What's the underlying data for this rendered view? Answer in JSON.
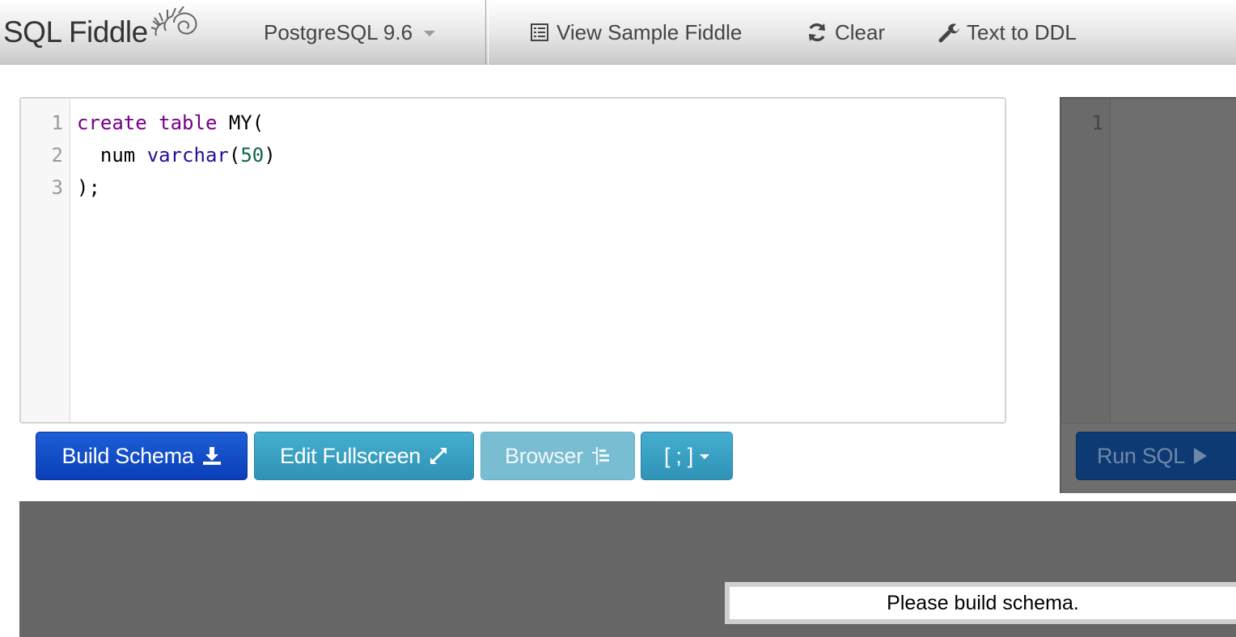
{
  "navbar": {
    "brand": "SQL Fiddle",
    "db_select": "PostgreSQL 9.6",
    "links": {
      "view_sample": "View Sample Fiddle",
      "clear": "Clear",
      "text_to_ddl": "Text to DDL"
    }
  },
  "schema_editor": {
    "line_numbers": [
      "1",
      "2",
      "3"
    ],
    "lines": [
      [
        {
          "t": "create",
          "c": "kw"
        },
        {
          "t": " ",
          "c": ""
        },
        {
          "t": "table",
          "c": "kw"
        },
        {
          "t": " MY(",
          "c": ""
        }
      ],
      [
        {
          "t": "  num ",
          "c": ""
        },
        {
          "t": "varchar",
          "c": "tp"
        },
        {
          "t": "(",
          "c": ""
        },
        {
          "t": "50",
          "c": "nm"
        },
        {
          "t": ")",
          "c": ""
        }
      ],
      [
        {
          "t": ");",
          "c": ""
        }
      ]
    ]
  },
  "query_editor": {
    "line_numbers": [
      "1"
    ]
  },
  "buttons": {
    "build_schema": "Build Schema",
    "edit_fullscreen": "Edit Fullscreen",
    "browser": "Browser",
    "terminator": "[ ; ]",
    "run_sql": "Run SQL"
  },
  "output": {
    "status": "Please build schema."
  },
  "icons": {
    "logo": "fiddlehead-logo",
    "db_caret": "chevron-down-icon",
    "view_sample": "list-icon",
    "clear": "refresh-icon",
    "text_to_ddl": "wrench-icon",
    "build_schema": "download-icon",
    "edit_fullscreen": "expand-icon",
    "browser": "tree-icon",
    "run_sql": "play-icon"
  },
  "colors": {
    "build_button": "#0a3eb8",
    "info_button": "#2f93b6",
    "run_button": "#0d3a73",
    "keyword": "#770088",
    "type": "#221199",
    "number": "#116644"
  }
}
